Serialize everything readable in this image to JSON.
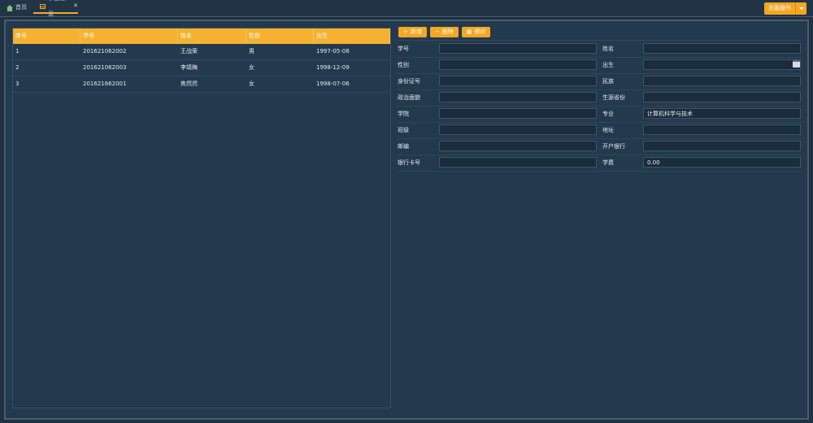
{
  "tabs": {
    "home": "首页",
    "student": "学生信息"
  },
  "page_ops": "页面操作",
  "toolbar": {
    "add": "新增",
    "delete": "删除",
    "save": "保存"
  },
  "grid": {
    "headers": [
      "序号",
      "学号",
      "姓名",
      "性别",
      "出生"
    ],
    "rows": [
      [
        "1",
        "201621062002",
        "王战荣",
        "男",
        "1997-05-08"
      ],
      [
        "2",
        "201621062003",
        "李靖梅",
        "女",
        "1998-12-09"
      ],
      [
        "3",
        "201621662001",
        "焦然然",
        "女",
        "1998-07-06"
      ]
    ]
  },
  "form": {
    "rows": [
      {
        "left_label": "学号",
        "left_value": "",
        "right_label": "姓名",
        "right_value": ""
      },
      {
        "left_label": "性别",
        "left_value": "",
        "right_label": "出生",
        "right_value": ""
      },
      {
        "left_label": "身份证号",
        "left_value": "",
        "right_label": "民族",
        "right_value": ""
      },
      {
        "left_label": "政治面貌",
        "left_value": "",
        "right_label": "生源省份",
        "right_value": ""
      },
      {
        "left_label": "学院",
        "left_value": "",
        "right_label": "专业",
        "right_value": "计算机科学与技术"
      },
      {
        "left_label": "班级",
        "left_value": "",
        "right_label": "地址",
        "right_value": ""
      },
      {
        "left_label": "邮编",
        "left_value": "",
        "right_label": "开户银行",
        "right_value": ""
      },
      {
        "left_label": "银行卡号",
        "left_value": "",
        "right_label": "学费",
        "right_value": "0.00"
      }
    ]
  },
  "colors": {
    "accent": "#f5a623",
    "background": "#233a4e"
  }
}
